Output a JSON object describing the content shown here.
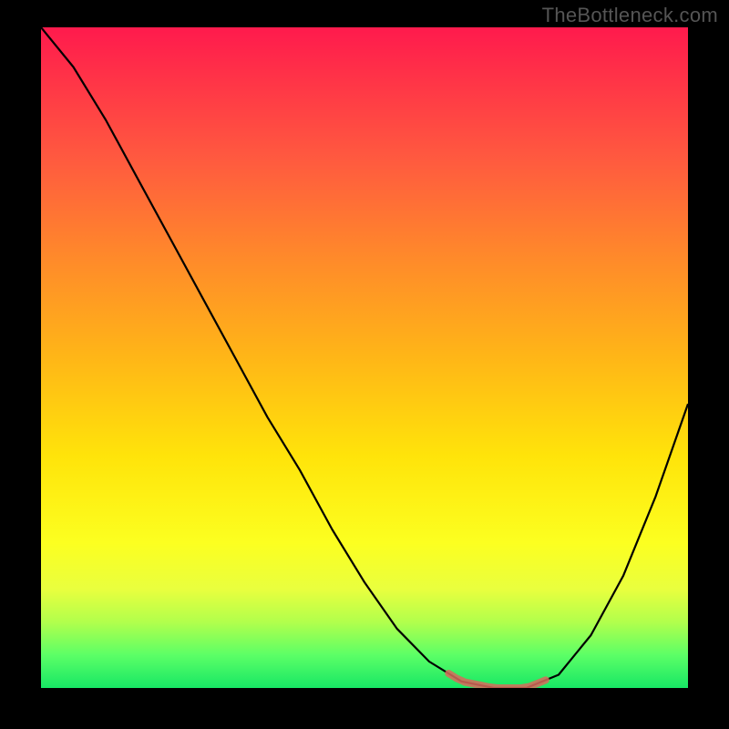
{
  "watermark": "TheBottleneck.com",
  "colors": {
    "frame_bg": "#000000",
    "curve_stroke": "#000000",
    "highlight_stroke": "#d86a5c",
    "gradient_stops": [
      "#ff1a4d",
      "#ff3447",
      "#ff5a3f",
      "#ff8a2a",
      "#ffb617",
      "#ffe40a",
      "#fcff20",
      "#e9ff3e",
      "#b2ff4c",
      "#5cff66",
      "#17e765"
    ]
  },
  "chart_data": {
    "type": "line",
    "title": "",
    "xlabel": "",
    "ylabel": "",
    "x": [
      0.0,
      0.05,
      0.1,
      0.15,
      0.2,
      0.25,
      0.3,
      0.35,
      0.4,
      0.45,
      0.5,
      0.55,
      0.6,
      0.65,
      0.7,
      0.75,
      0.8,
      0.85,
      0.9,
      0.95,
      1.0
    ],
    "values": [
      1.0,
      0.94,
      0.86,
      0.77,
      0.68,
      0.59,
      0.5,
      0.41,
      0.33,
      0.24,
      0.16,
      0.09,
      0.04,
      0.01,
      0.0,
      0.0,
      0.02,
      0.08,
      0.17,
      0.29,
      0.43
    ],
    "ylim": [
      0,
      1
    ],
    "xlim": [
      0,
      1
    ],
    "highlight_range_x": [
      0.63,
      0.78
    ],
    "notes": "Single black V-shaped curve over a red→green vertical gradient. Reddish highlight segment sits on the valley floor near x≈0.63–0.78."
  }
}
